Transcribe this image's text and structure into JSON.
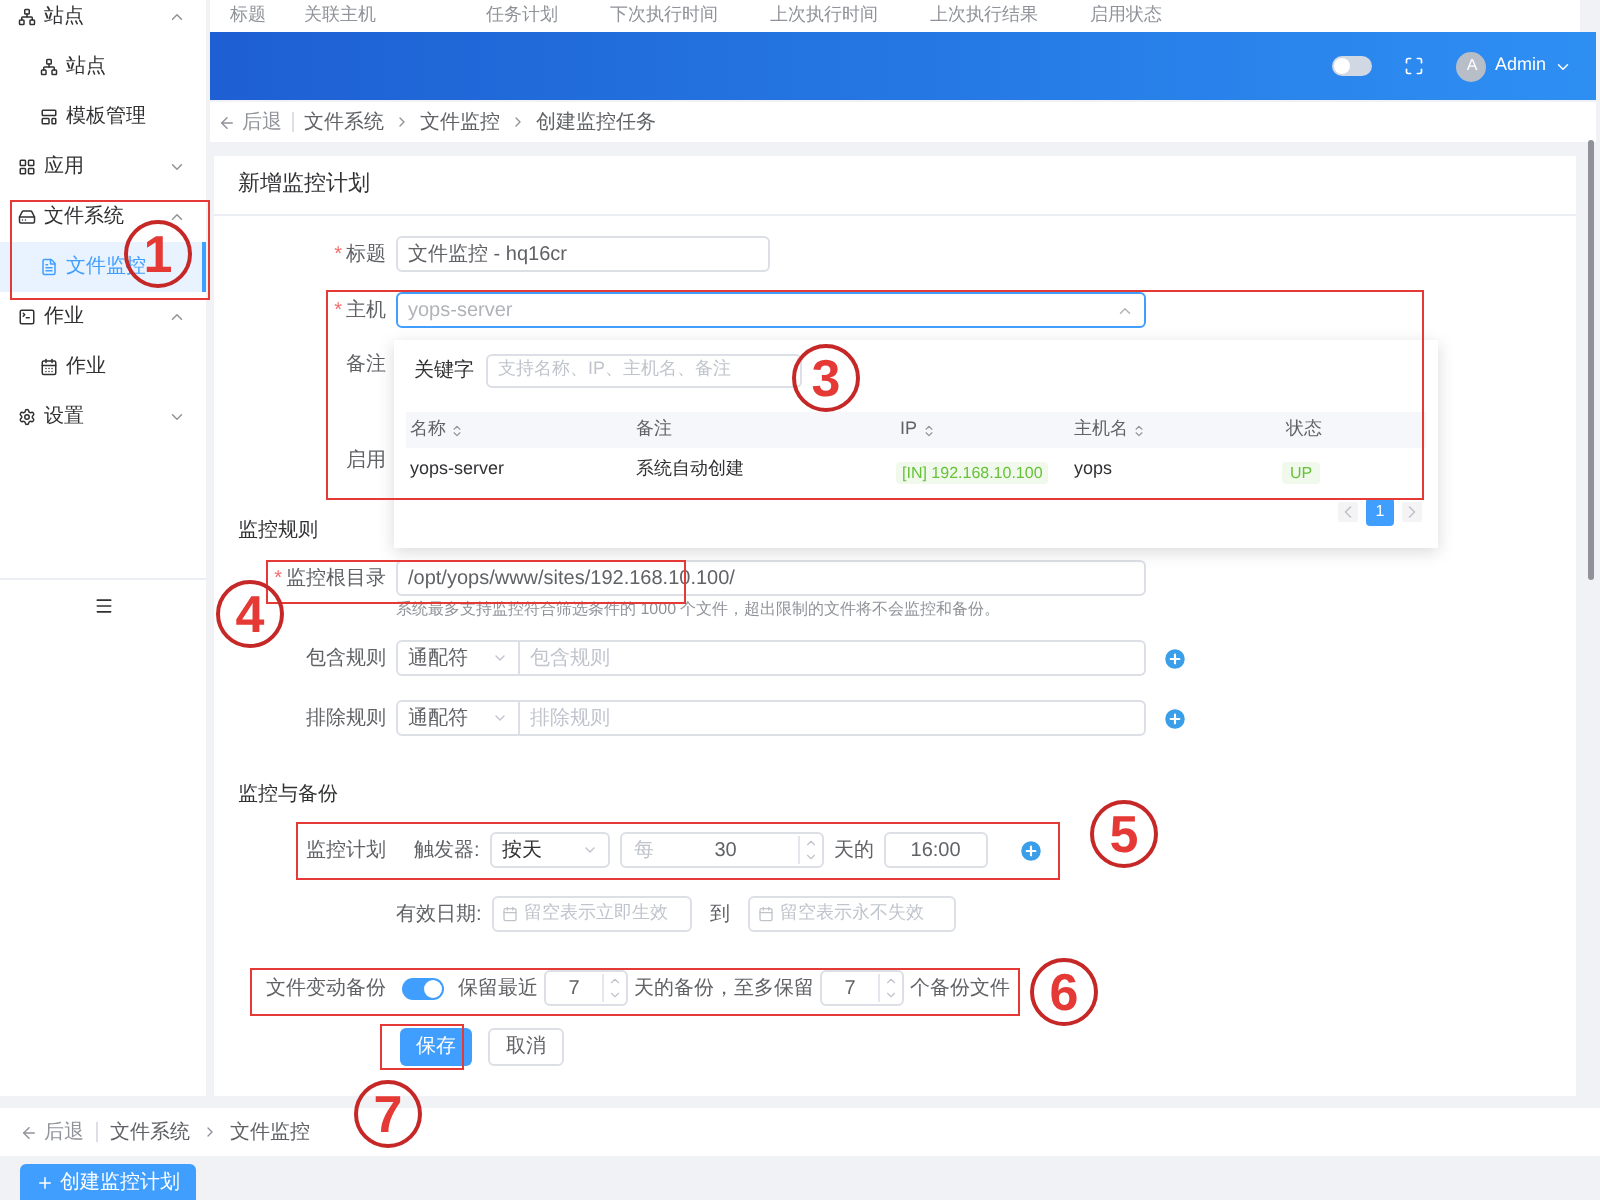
{
  "background_table": {
    "columns": [
      "标题",
      "关联主机",
      "任务计划",
      "下次执行时间",
      "上次执行时间",
      "上次执行结果",
      "启用状态"
    ]
  },
  "sidebar": {
    "items": [
      {
        "label": "站点",
        "expanded": true,
        "children": [
          {
            "label": "站点",
            "selected": false
          },
          {
            "label": "模板管理",
            "selected": false
          }
        ]
      },
      {
        "label": "应用",
        "expanded": false
      },
      {
        "label": "文件系统",
        "expanded": true,
        "children": [
          {
            "label": "文件监控",
            "selected": true
          }
        ]
      },
      {
        "label": "作业",
        "expanded": true,
        "children": [
          {
            "label": "作业",
            "selected": false
          }
        ]
      },
      {
        "label": "设置",
        "expanded": false
      }
    ]
  },
  "header": {
    "theme_switch_on": false,
    "avatar": "A",
    "user": "Admin"
  },
  "breadcrumb": {
    "back": "后退",
    "items": [
      "文件系统",
      "文件监控",
      "创建监控任务"
    ]
  },
  "form": {
    "title": "新增监控计划",
    "title_field": {
      "label": "标题",
      "required_mark": "*",
      "value": "文件监控 - hq16cr"
    },
    "host_field": {
      "label": "主机",
      "required_mark": "*",
      "placeholder": "yops-server",
      "expanded": true
    },
    "remark_label": "备注",
    "enable_label": "启用",
    "rules": {
      "heading": "监控规则",
      "root_dir": {
        "label": "监控根目录",
        "required_mark": "*",
        "value": "/opt/yops/www/sites/192.168.10.100/"
      },
      "help": "系统最多支持监控符合筛选条件的 1000 个文件，超出限制的文件将不会监控和备份。",
      "filters": [
        {
          "label": "包含规则",
          "match": "通配符",
          "placeholder": "包含规则"
        },
        {
          "label": "排除规则",
          "match": "通配符",
          "placeholder": "排除规则"
        }
      ]
    },
    "backup": {
      "heading": "监控与备份",
      "schedule": {
        "label": "监控计划",
        "trigger_label": "触发器:",
        "trigger": "按天",
        "every_prefix": "每",
        "every": "30",
        "day_suffix": "天的",
        "time": "16:00"
      },
      "validity": {
        "label": "有效日期:",
        "start_placeholder": "留空表示立即生效",
        "to": "到",
        "end_placeholder": "留空表示永不失效"
      },
      "file_backup": {
        "label": "文件变动备份",
        "on": true,
        "keep_prefix": "保留最近",
        "keep_days": "7",
        "days_suffix": "天的备份，至多保留",
        "keep_count": "7",
        "count_suffix": "个备份文件"
      }
    },
    "actions": [
      {
        "label": "保存",
        "kind": "primary"
      },
      {
        "label": "取消",
        "kind": "default"
      }
    ]
  },
  "host_dropdown": {
    "keyword_label": "关键字",
    "keyword_placeholder": "支持名称、IP、主机名、备注",
    "columns": [
      {
        "label": "名称",
        "sortable": true
      },
      {
        "label": "备注",
        "sortable": false
      },
      {
        "label": "IP",
        "sortable": true
      },
      {
        "label": "主机名",
        "sortable": true
      },
      {
        "label": "状态",
        "sortable": false
      }
    ],
    "rows": [
      {
        "name": "yops-server",
        "remark": "系统自动创建",
        "ip": "[IN] 192.168.10.100",
        "hostname": "yops",
        "status": "UP"
      }
    ],
    "pages": [
      {
        "label": "1",
        "selected": true
      }
    ]
  },
  "footer": {
    "back": "后退",
    "breadcrumb": [
      "文件系统",
      "文件监控"
    ],
    "create_button": "创建监控计划"
  },
  "annotations": [
    {
      "number": "1"
    },
    {
      "number": "3"
    },
    {
      "number": "4"
    },
    {
      "number": "5"
    },
    {
      "number": "6"
    },
    {
      "number": "7"
    }
  ]
}
